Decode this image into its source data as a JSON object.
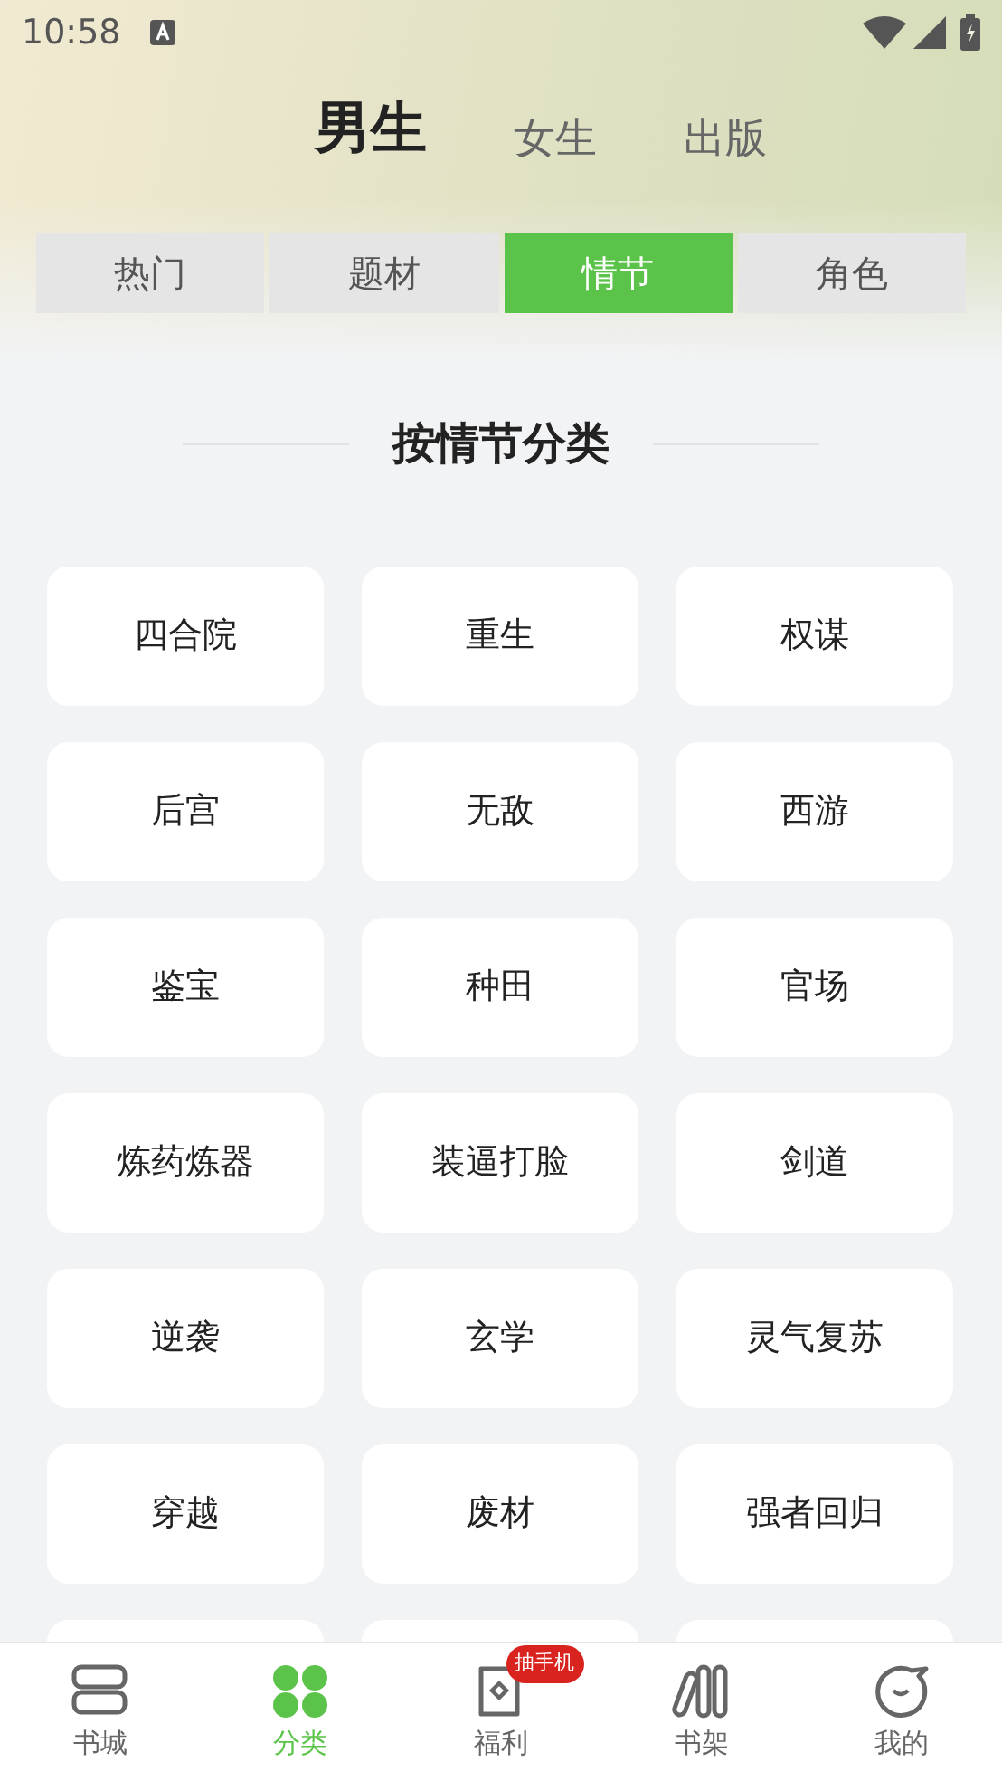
{
  "status_bar": {
    "time": "10:58"
  },
  "gender_tabs": [
    {
      "label": "男生",
      "selected": true
    },
    {
      "label": "女生",
      "selected": false
    },
    {
      "label": "出版",
      "selected": false
    }
  ],
  "segments": [
    {
      "label": "热门",
      "selected": false
    },
    {
      "label": "题材",
      "selected": false
    },
    {
      "label": "情节",
      "selected": true
    },
    {
      "label": "角色",
      "selected": false
    }
  ],
  "section_title": "按情节分类",
  "categories": [
    {
      "kind": "full",
      "label": "四合院"
    },
    {
      "kind": "full",
      "label": "重生"
    },
    {
      "kind": "full",
      "label": "权谋"
    },
    {
      "kind": "full",
      "label": "后宫"
    },
    {
      "kind": "full",
      "label": "无敌"
    },
    {
      "kind": "full",
      "label": "西游"
    },
    {
      "kind": "full",
      "label": "鉴宝"
    },
    {
      "kind": "full",
      "label": "种田"
    },
    {
      "kind": "full",
      "label": "官场"
    },
    {
      "kind": "full",
      "label": "炼药炼器"
    },
    {
      "kind": "full",
      "label": "装逼打脸"
    },
    {
      "kind": "full",
      "label": "剑道"
    },
    {
      "kind": "full",
      "label": "逆袭"
    },
    {
      "kind": "full",
      "label": "玄学"
    },
    {
      "kind": "full",
      "label": "灵气复苏"
    },
    {
      "kind": "full",
      "label": "穿越"
    },
    {
      "kind": "full",
      "label": "废材"
    },
    {
      "kind": "full",
      "label": "强者回归"
    },
    {
      "kind": "partial"
    },
    {
      "kind": "partial"
    },
    {
      "kind": "partial"
    }
  ],
  "bottom_nav": [
    {
      "kind": "books",
      "label": "书城",
      "selected": false
    },
    {
      "kind": "clover",
      "label": "分类",
      "selected": true
    },
    {
      "kind": "gift",
      "label": "福利",
      "selected": false,
      "badge": "抽手机"
    },
    {
      "kind": "shelf",
      "label": "书架",
      "selected": false
    },
    {
      "kind": "face",
      "label": "我的",
      "selected": false
    }
  ]
}
